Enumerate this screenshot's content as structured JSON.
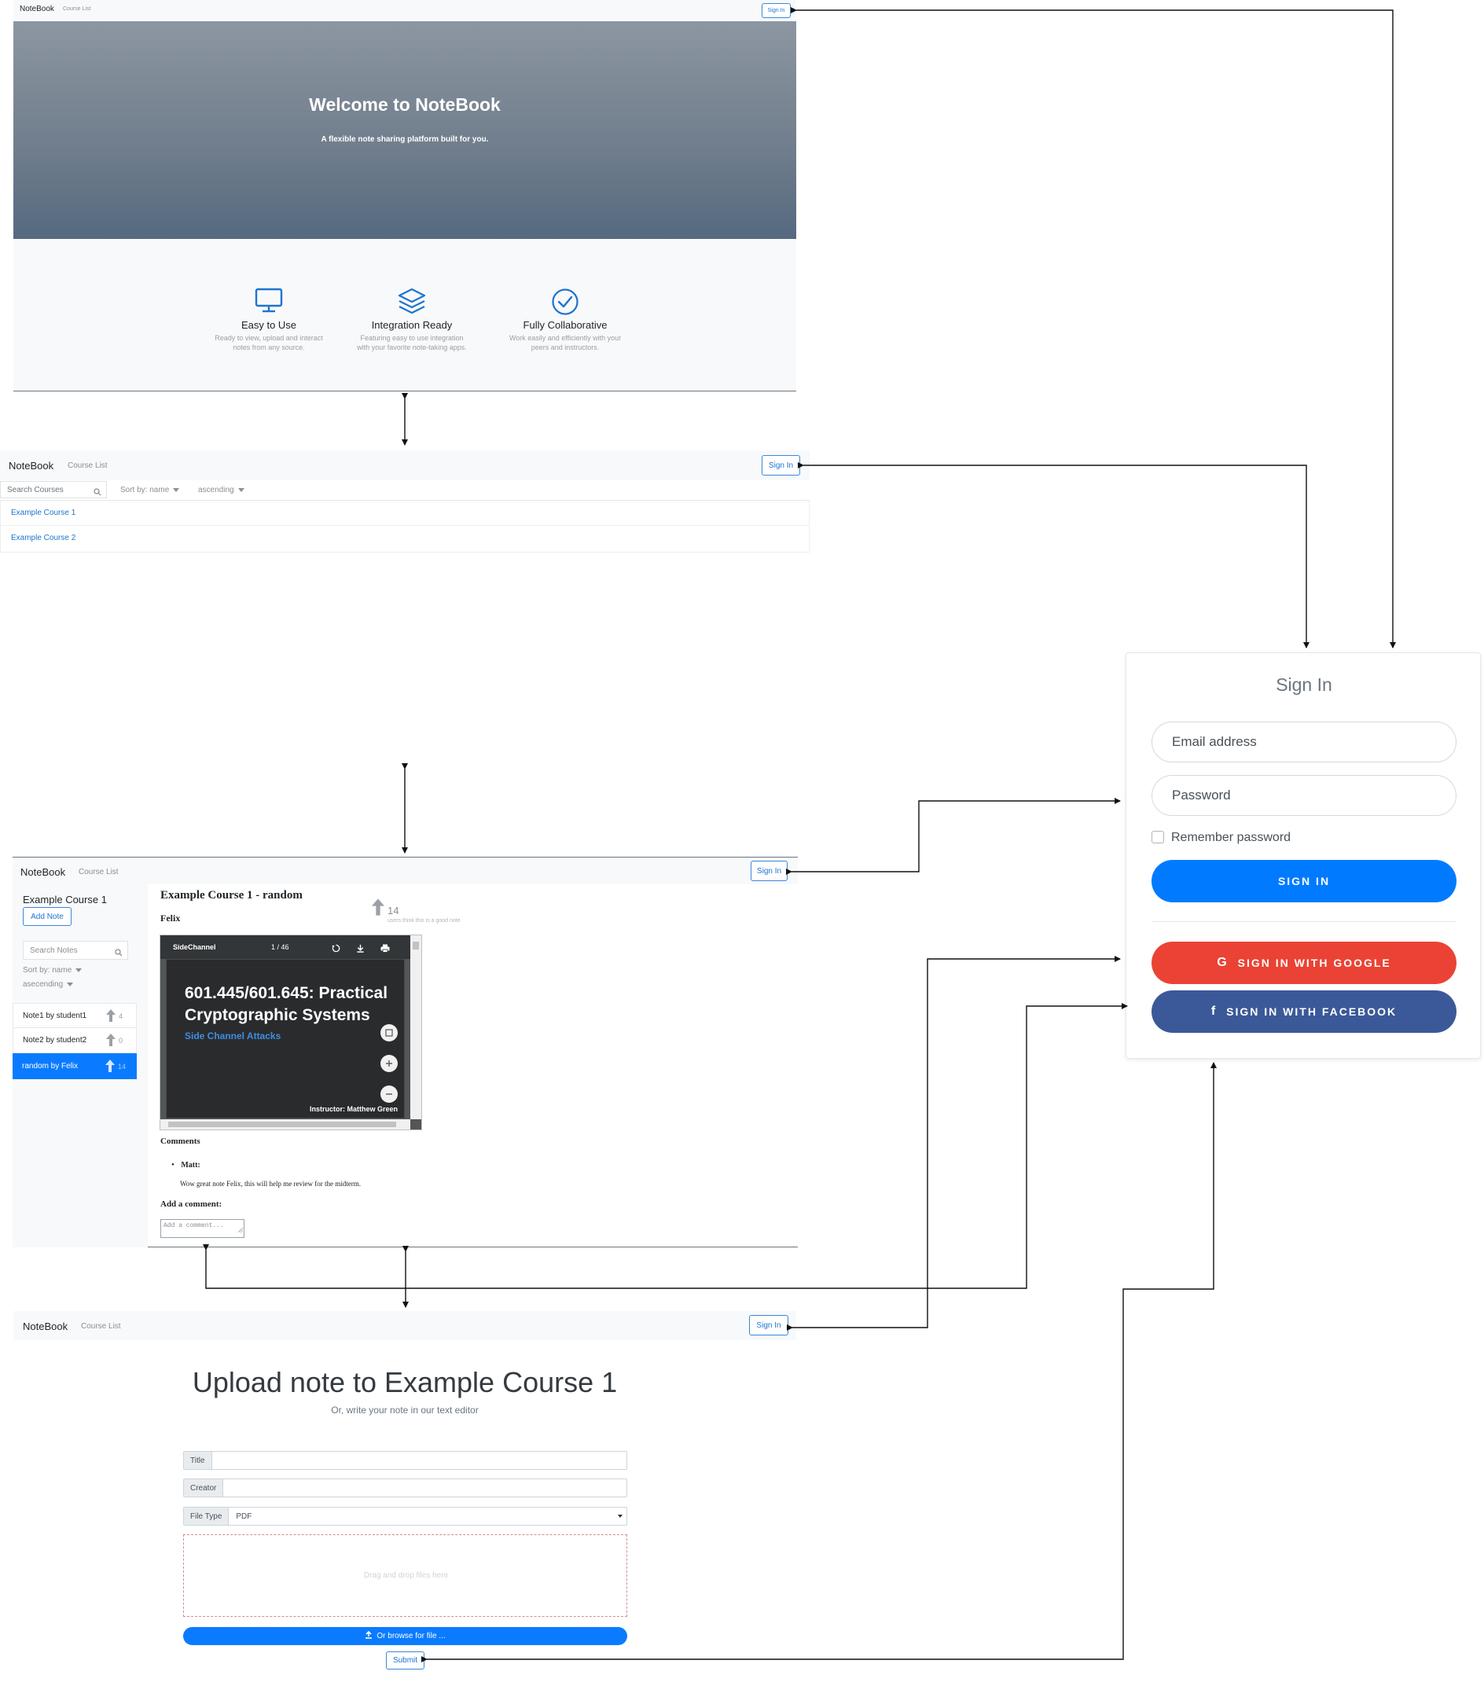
{
  "app": {
    "brand": "NoteBook",
    "nav_course_list": "Course List",
    "sign_in": "Sign In"
  },
  "home": {
    "hero_title": "Welcome to NoteBook",
    "hero_subtitle": "A flexible note sharing platform built for you.",
    "features": [
      {
        "icon": "monitor-icon",
        "title": "Easy to Use",
        "line1": "Ready to view, upload and interact",
        "line2": "notes from any source."
      },
      {
        "icon": "layers-icon",
        "title": "Integration Ready",
        "line1": "Featuring easy to use integration",
        "line2": "with your favorite note-taking apps."
      },
      {
        "icon": "check-circle-icon",
        "title": "Fully Collaborative",
        "line1": "Work easily and efficiently with your",
        "line2": "peers and instructors."
      }
    ]
  },
  "course_list": {
    "search_placeholder": "Search Courses",
    "sort_label": "Sort by: name",
    "order_label": "ascending",
    "courses": [
      "Example Course 1",
      "Example Course 2"
    ]
  },
  "course_page": {
    "course_title": "Example Course 1",
    "add_note": "Add Note",
    "search_placeholder": "Search Notes",
    "sort_label": "Sort by: name",
    "order_label": "asecending",
    "notes": [
      {
        "label": "Note1 by student1",
        "votes": "4"
      },
      {
        "label": "Note2 by student2",
        "votes": "0"
      },
      {
        "label": "random by Felix",
        "votes": "14"
      }
    ],
    "note_heading": "Example Course 1 - random",
    "note_author": "Felix",
    "vote_count": "14",
    "vote_caption": "users think this is a good note",
    "pdf": {
      "filename": "SideChannel",
      "page": "1 / 46",
      "slide_title_line1": "601.445/601.645: Practical",
      "slide_title_line2": "Cryptographic Systems",
      "slide_subtitle": "Side Channel Attacks",
      "slide_instructor": "Instructor: Matthew Green"
    },
    "comments_heading": "Comments",
    "comment_author": "Matt:",
    "comment_text": "Wow great note Felix, this will help me review for the midterm.",
    "add_comment_heading": "Add a comment:",
    "comment_placeholder": "Add a comment..."
  },
  "upload": {
    "heading": "Upload note to Example Course 1",
    "subheading": "Or, write your note in our text editor",
    "title_label": "Title",
    "creator_label": "Creator",
    "filetype_label": "File Type",
    "filetype_value": "PDF",
    "dropzone_text": "Drag and drop files here",
    "browse_label": "Or browse for file ...",
    "submit_label": "Submit"
  },
  "signin_modal": {
    "title": "Sign In",
    "email_placeholder": "Email address",
    "password_placeholder": "Password",
    "remember_label": "Remember password",
    "signin_button": "SIGN IN",
    "google_button": "SIGN IN WITH GOOGLE",
    "facebook_button": "SIGN IN WITH FACEBOOK"
  },
  "colors": {
    "primary": "#007bff",
    "google": "#ea4335",
    "facebook": "#3b5998",
    "navbar_bg": "#f8f9fa"
  }
}
